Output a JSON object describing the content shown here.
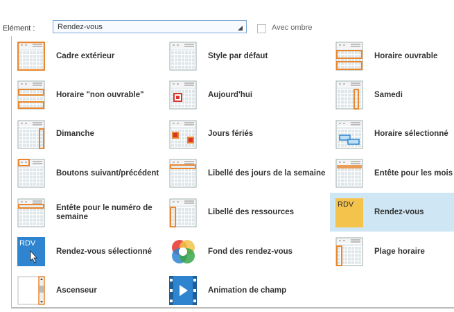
{
  "header": {
    "element_label": "Elément :",
    "element_value": "Rendez-vous",
    "shadow_label": "Avec ombre",
    "shadow_checked": false
  },
  "items": [
    {
      "label": "Cadre extérieur",
      "icon": "calendar-outer-frame-icon"
    },
    {
      "label": "Style par défaut",
      "icon": "calendar-default-style-icon"
    },
    {
      "label": "Horaire ouvrable",
      "icon": "calendar-working-hours-icon"
    },
    {
      "label": "Horaire \"non ouvrable\"",
      "icon": "calendar-non-working-hours-icon"
    },
    {
      "label": "Aujourd'hui",
      "icon": "calendar-today-icon"
    },
    {
      "label": "Samedi",
      "icon": "calendar-saturday-icon"
    },
    {
      "label": "Dimanche",
      "icon": "calendar-sunday-icon"
    },
    {
      "label": "Jours fériés",
      "icon": "calendar-holidays-icon"
    },
    {
      "label": "Horaire sélectionné",
      "icon": "calendar-selected-hours-icon"
    },
    {
      "label": "Boutons suivant/précédent",
      "icon": "calendar-nav-buttons-icon"
    },
    {
      "label": "Libellé des jours de la semaine",
      "icon": "calendar-weekday-labels-icon"
    },
    {
      "label": "Entête pour les mois",
      "icon": "calendar-month-header-icon"
    },
    {
      "label": "Entête pour le numéro de semaine",
      "icon": "calendar-week-number-icon"
    },
    {
      "label": "Libellé des ressources",
      "icon": "calendar-resources-label-icon"
    },
    {
      "label": "Rendez-vous",
      "icon": "appointment-icon",
      "icon_text": "RDV",
      "selected": true
    },
    {
      "label": "Rendez-vous sélectionné",
      "icon": "selected-appointment-icon",
      "icon_text": "RDV"
    },
    {
      "label": "Fond des rendez-vous",
      "icon": "appointment-background-icon"
    },
    {
      "label": "Plage horaire",
      "icon": "calendar-time-range-icon"
    },
    {
      "label": "Ascenseur",
      "icon": "scrollbar-icon"
    },
    {
      "label": "Animation de champ",
      "icon": "field-animation-icon"
    }
  ],
  "colors": {
    "accent_orange": "#e8872e",
    "selection_blue": "#cfe6f5",
    "rdv_yellow": "#f3c34b",
    "rdv_selected_blue": "#2f84d0",
    "holiday_red": "#d9332b"
  }
}
